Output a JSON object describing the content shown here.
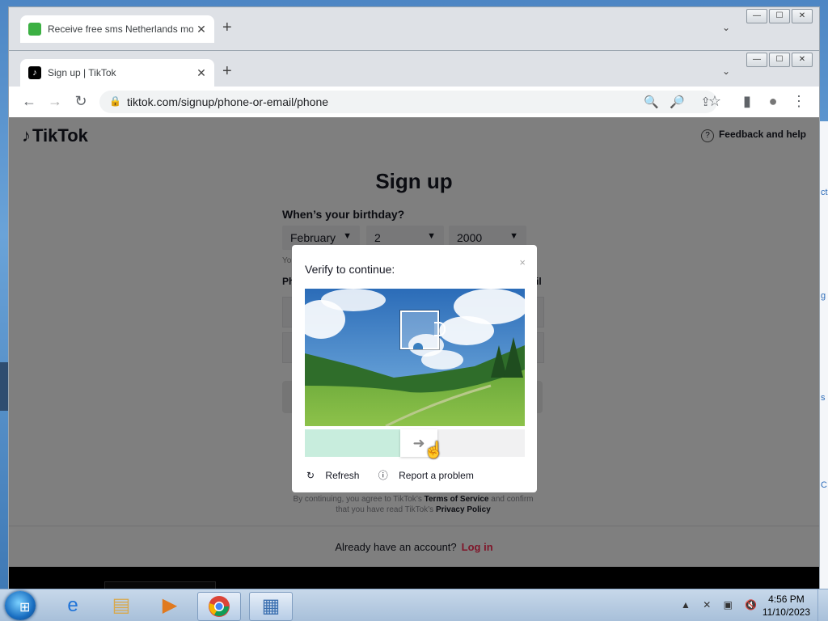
{
  "back_window": {
    "tab_title": "Receive free sms Netherlands mo",
    "tab_close": "✕",
    "new_tab": "+",
    "tab_list": "⌄",
    "controls": [
      "—",
      "☐",
      "✕"
    ]
  },
  "front_window": {
    "tab_title": "Sign up | TikTok",
    "tab_close": "✕",
    "new_tab": "+",
    "tab_list": "⌄",
    "controls": [
      "—",
      "☐",
      "✕"
    ]
  },
  "toolbar": {
    "back": "←",
    "forward": "→",
    "reload": "↻",
    "lock": "🔒",
    "url": "tiktok.com/signup/phone-or-email/phone",
    "search_icon": "🔍",
    "zoom_icon": "🔎",
    "share_icon": "⇪",
    "star_icon": "☆",
    "sidepanel_icon": "▮",
    "profile_icon": "●",
    "menu_icon": "⋮"
  },
  "page": {
    "logo": "TikTok",
    "logo_note": "♪",
    "feedback": "Feedback and help",
    "feedback_q": "?",
    "heading": "Sign up",
    "birthday_label": "When’s your birthday?",
    "month": "February",
    "day": "2",
    "year": "2000",
    "caret": "▼",
    "hint_fragment": "Yo",
    "phone_label_fragment": "Ph",
    "right_fragment": "il",
    "terms_line1_a": "By continuing, you agree to TikTok’s",
    "terms_link": "Terms of Service",
    "terms_line1_b": "and confirm",
    "terms_line2_a": "that you have read TikTok’s",
    "privacy_link": "Privacy Policy",
    "already": "Already have an account?",
    "login": "Log in"
  },
  "captcha": {
    "title": "Verify to continue:",
    "close": "×",
    "slider_arrow": "➜",
    "refresh": "Refresh",
    "refresh_icon": "↻",
    "report": "Report a problem",
    "report_icon": "ⓘ",
    "slider_progress": 0.43
  },
  "taskbar": {
    "time": "4:56 PM",
    "date": "11/10/2023",
    "tray_icons": "▲ ✕ ▣ 🔇"
  },
  "colors": {
    "tiktok_red": "#fe2c55",
    "slider_fill": "#c8eddd"
  }
}
